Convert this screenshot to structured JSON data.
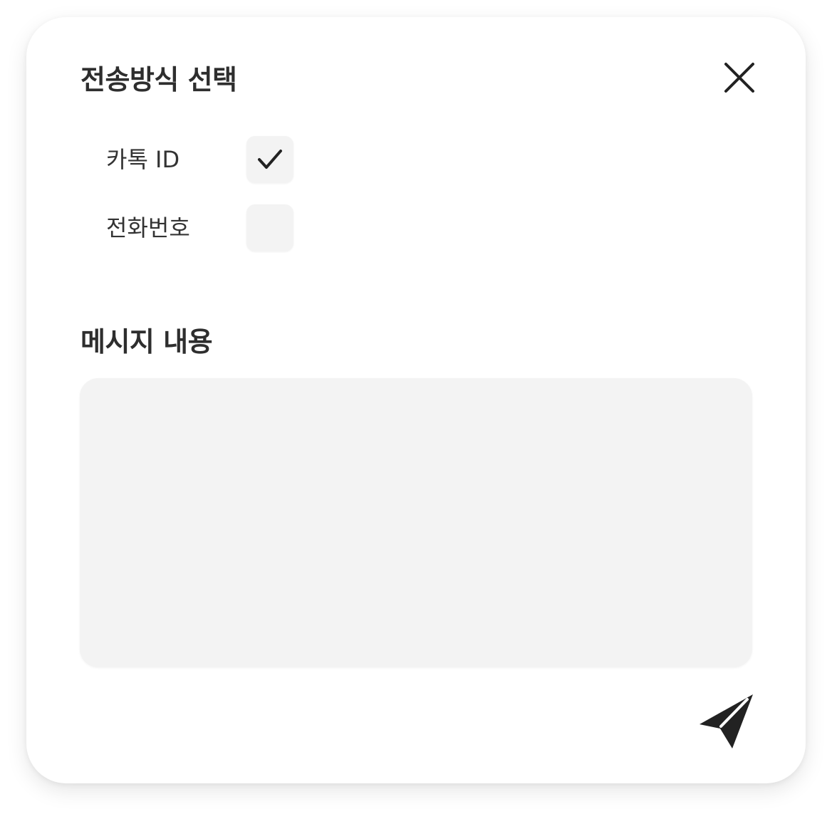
{
  "dialog": {
    "title": "전송방식 선택",
    "close_icon": "close-icon"
  },
  "options": [
    {
      "label": "카톡 ID",
      "checked": true
    },
    {
      "label": "전화번호",
      "checked": false
    }
  ],
  "message": {
    "label": "메시지 내용",
    "value": "",
    "placeholder": ""
  },
  "send": {
    "icon": "send-icon"
  },
  "colors": {
    "background": "#ffffff",
    "field_fill": "#f3f3f3",
    "text": "#2e2e2e",
    "icon": "#222222"
  }
}
